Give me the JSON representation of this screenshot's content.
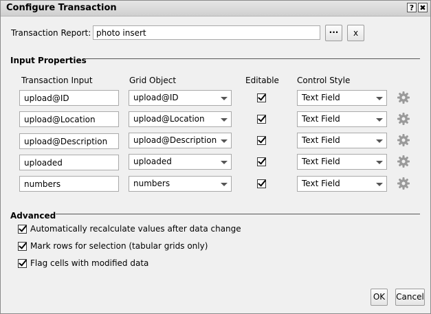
{
  "window": {
    "title": "Configure Transaction",
    "help_label": "?",
    "close_label": "✖"
  },
  "report": {
    "label": "Transaction Report:",
    "value": "photo insert",
    "browse_label": "···",
    "clear_label": "x"
  },
  "input_properties": {
    "heading": "Input Properties",
    "headers": {
      "input": "Transaction Input",
      "grid": "Grid Object",
      "editable": "Editable",
      "style": "Control Style"
    },
    "rows": [
      {
        "input": "upload@ID",
        "grid": "upload@ID",
        "editable": true,
        "style": "Text Field"
      },
      {
        "input": "upload@Location",
        "grid": "upload@Location",
        "editable": true,
        "style": "Text Field"
      },
      {
        "input": "upload@Description",
        "grid": "upload@Description",
        "editable": true,
        "style": "Text Field"
      },
      {
        "input": "uploaded",
        "grid": "uploaded",
        "editable": true,
        "style": "Text Field"
      },
      {
        "input": "numbers",
        "grid": "numbers",
        "editable": true,
        "style": "Text Field"
      }
    ]
  },
  "advanced": {
    "heading": "Advanced",
    "options": [
      {
        "label": "Automatically recalculate values after data change",
        "checked": true
      },
      {
        "label": "Mark rows for selection (tabular grids only)",
        "checked": true
      },
      {
        "label": "Flag cells with modified data",
        "checked": true
      }
    ]
  },
  "footer": {
    "ok_label": "OK",
    "cancel_label": "Cancel"
  },
  "icons": {
    "gear": "gear-icon",
    "check": "check-icon",
    "dropdown": "chevron-down-icon"
  }
}
